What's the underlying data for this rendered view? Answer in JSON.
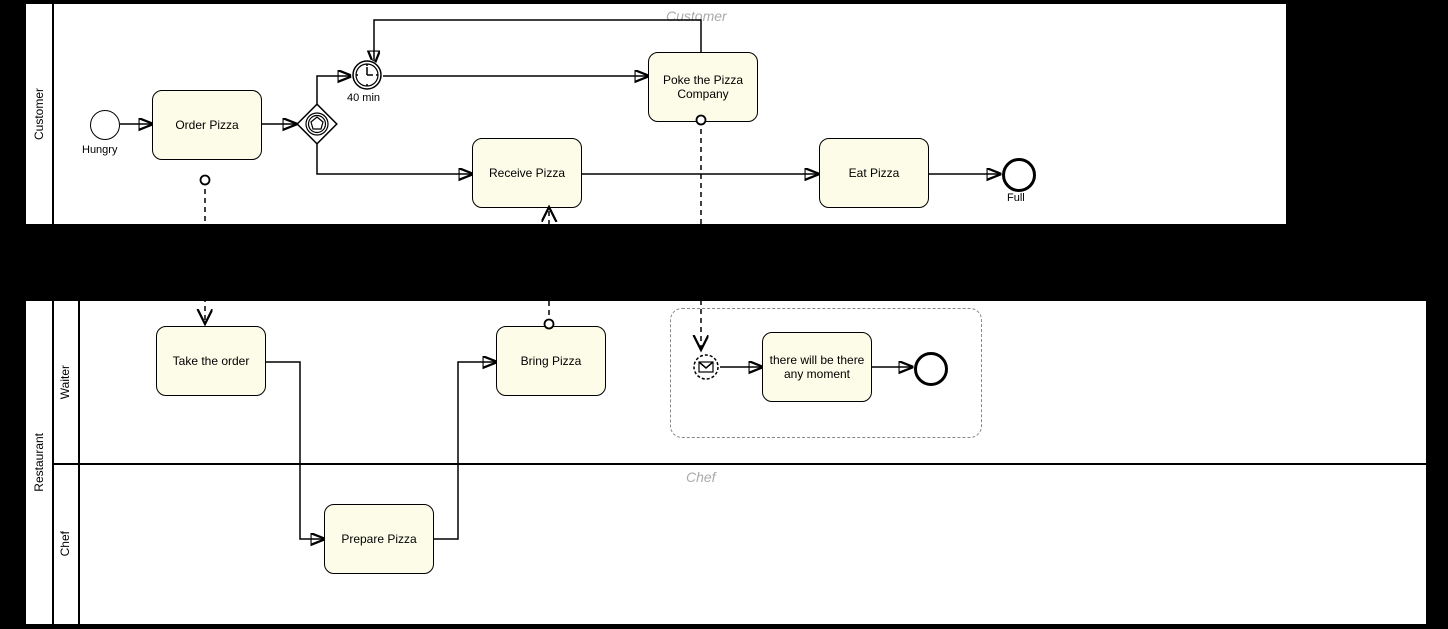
{
  "pools": {
    "customer": {
      "title": "Customer",
      "watermark": "Customer"
    },
    "restaurant": {
      "title": "Restaurant",
      "watermark": "Chef",
      "lanes": {
        "waiter": "Waiter",
        "chef": "Chef"
      }
    }
  },
  "customer_tasks": {
    "order": "Order Pizza",
    "receive": "Receive Pizza",
    "poke": "Poke the Pizza Company",
    "eat": "Eat Pizza"
  },
  "customer_events": {
    "start_label": "Hungry",
    "timer_label": "40 min",
    "end_label": "Full"
  },
  "restaurant_tasks": {
    "take": "Take the order",
    "bring": "Bring Pizza",
    "prepare": "Prepare Pizza",
    "reply": "there will be there any moment"
  }
}
